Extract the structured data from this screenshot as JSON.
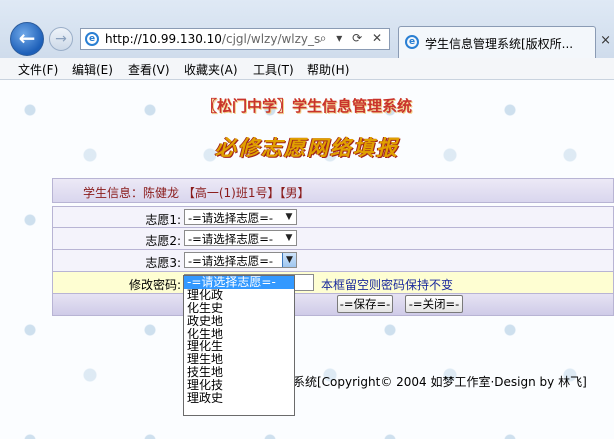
{
  "browser": {
    "url_host": "http://10.99.130.10",
    "url_path": "/cjgl/wlzy/wlzy_s",
    "addr_buttons": "⌕ ▾ ⟳ ✕",
    "tab_title": "学生信息管理系统[版权所...",
    "tab_close": "×",
    "back_icon": "←",
    "forward_icon": "→"
  },
  "menu": [
    {
      "label": "文件(F)"
    },
    {
      "label": "编辑(E)"
    },
    {
      "label": "查看(V)"
    },
    {
      "label": "收藏夹(A)"
    },
    {
      "label": "工具(T)"
    },
    {
      "label": "帮助(H)"
    }
  ],
  "page": {
    "school_title": "〖松门中学〗学生信息管理系统",
    "subtitle": "必修志愿网络填报",
    "student_info": "学生信息：陈健龙 【高一(1)班1号】【男】",
    "form": {
      "choice1_label": "志愿1:",
      "choice1_value": "-=请选择志愿=-",
      "choice2_label": "志愿2:",
      "choice2_value": "-=请选择志愿=-",
      "choice3_label": "志愿3:",
      "choice3_value": "-=请选择志愿=-",
      "password_label": "修改密码:",
      "password_value": "",
      "password_hint": "本框留空则密码保持不变",
      "save_label": "-=保存=-",
      "close_label": "-=关闭=-"
    },
    "footer": "系统[Copyright© 2004 如梦工作室·Design by 林飞]"
  },
  "dropdown": {
    "options": [
      {
        "label": "-=请选择志愿=-",
        "selected": true
      },
      {
        "label": "理化政"
      },
      {
        "label": "化生史"
      },
      {
        "label": "政史地"
      },
      {
        "label": "化生地"
      },
      {
        "label": "理化生"
      },
      {
        "label": "理生地"
      },
      {
        "label": "技生地"
      },
      {
        "label": "理化技"
      },
      {
        "label": "理政史"
      }
    ]
  }
}
